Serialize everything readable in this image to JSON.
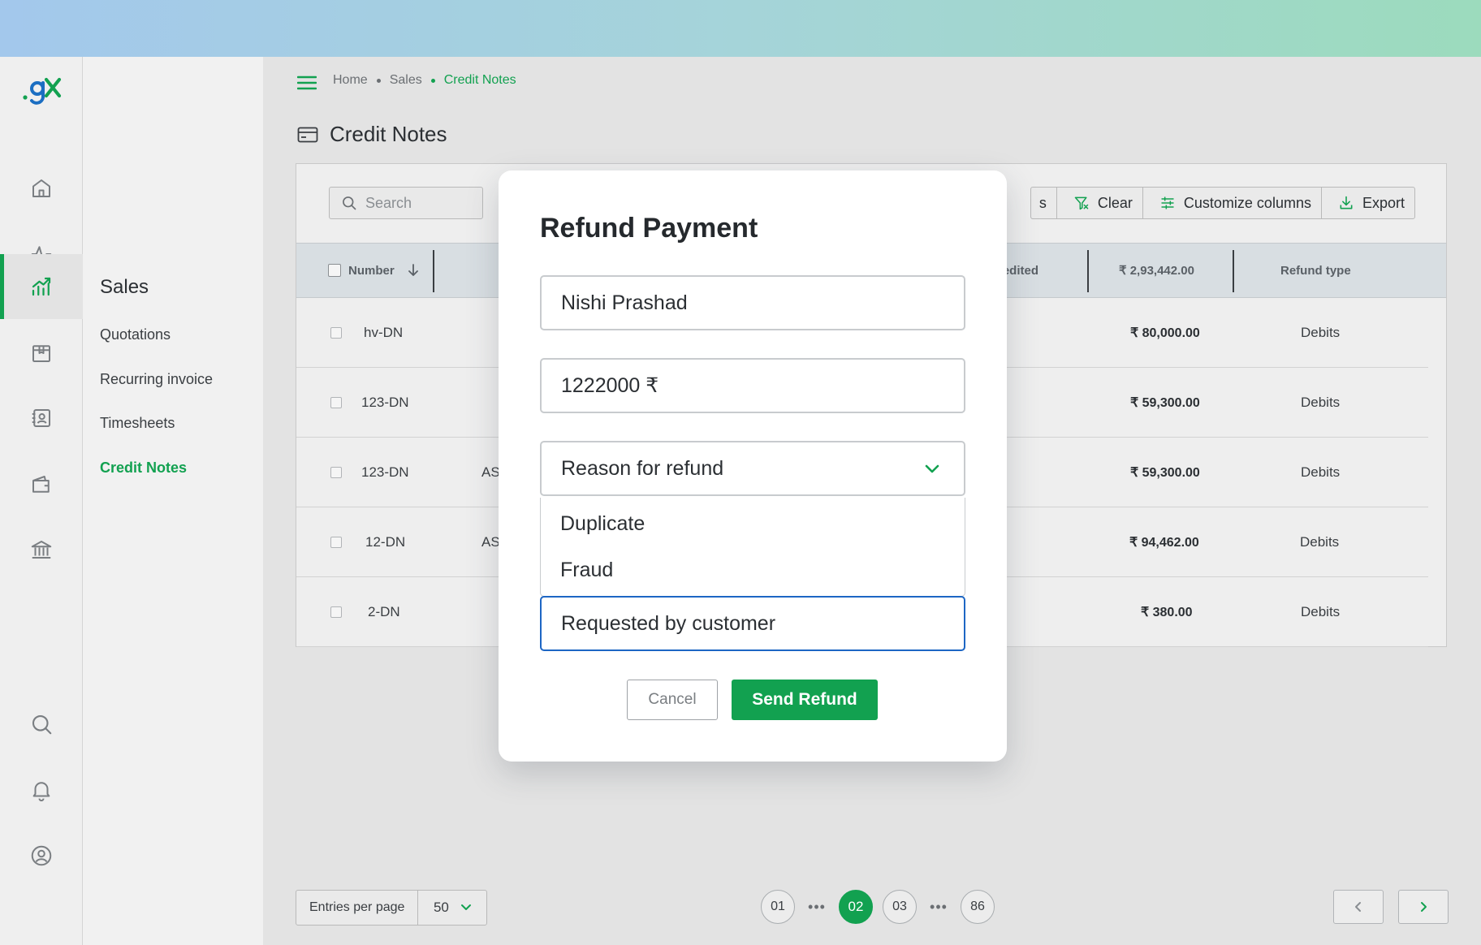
{
  "breadcrumb": {
    "home": "Home",
    "sales": "Sales",
    "current": "Credit Notes"
  },
  "page": {
    "title": "Credit Notes"
  },
  "subnav": {
    "title": "Sales",
    "items": [
      {
        "label": "Quotations"
      },
      {
        "label": "Recurring invoice"
      },
      {
        "label": "Timesheets"
      },
      {
        "label": "Credit Notes"
      }
    ]
  },
  "rail": {
    "icons": [
      "home-icon",
      "activity-icon",
      "sales-chart-icon",
      "box-icon",
      "contacts-icon",
      "wallet-icon",
      "bank-icon",
      "search-icon",
      "bell-icon",
      "profile-icon"
    ],
    "active": "sales-chart-icon"
  },
  "search": {
    "placeholder": "Search"
  },
  "toolbar": {
    "partial_label": "s",
    "clear": "Clear",
    "customize": "Customize columns",
    "export": "Export"
  },
  "table": {
    "headers": {
      "number": "Number",
      "credited": "redited",
      "total": "₹ 2,93,442.00",
      "refund_type": "Refund type"
    },
    "rows": [
      {
        "number": "hv-DN",
        "col2": "",
        "amount": "₹ 80,000.00",
        "type": "Debits"
      },
      {
        "number": "123-DN",
        "col2": "",
        "amount": "₹ 59,300.00",
        "type": "Debits"
      },
      {
        "number": "123-DN",
        "col2": "AS",
        "amount": "₹ 59,300.00",
        "type": "Debits"
      },
      {
        "number": "12-DN",
        "col2": "ASI",
        "amount": "₹ 94,462.00",
        "type": "Debits"
      },
      {
        "number": "2-DN",
        "col2": "",
        "amount": "₹ 380.00",
        "type": "Debits"
      }
    ]
  },
  "footer": {
    "entries_label": "Entries per page",
    "entries_value": "50",
    "pages": [
      "01",
      "02",
      "03",
      "86"
    ],
    "dots": "•••",
    "current_page": "02"
  },
  "modal": {
    "title": "Refund Payment",
    "name_value": "Nishi Prashad",
    "amount_value": "1222000 ₹",
    "reason_placeholder": "Reason for refund",
    "reason_options": [
      "Duplicate",
      "Fraud"
    ],
    "reason_selected": "Requested by customer",
    "cancel": "Cancel",
    "send": "Send Refund"
  },
  "colors": {
    "accent": "#12a150",
    "focus": "#1d66c4"
  }
}
